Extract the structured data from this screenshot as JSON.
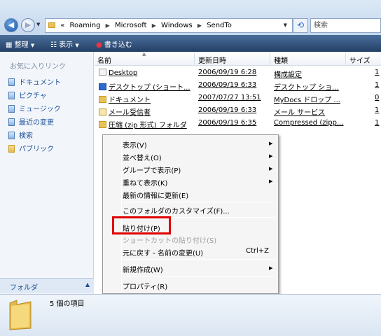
{
  "address": {
    "overflow": "«",
    "crumbs": [
      "Roaming",
      "Microsoft",
      "Windows",
      "SendTo"
    ],
    "search_placeholder": "検索"
  },
  "toolbar": {
    "organize": "整理",
    "views": "表示",
    "burn": "書き込む"
  },
  "nav": {
    "favorites_header": "お気に入りリンク",
    "items": [
      "ドキュメント",
      "ピクチャ",
      "ミュージック",
      "最近の変更",
      "検索",
      "パブリック"
    ],
    "folders_label": "フォルダ"
  },
  "columns": {
    "name": "名前",
    "date": "更新日時",
    "type": "種類",
    "size": "サイズ"
  },
  "files": [
    {
      "name": "Desktop",
      "date": "2006/09/19 6:28",
      "type": "構成設定",
      "size": "1"
    },
    {
      "name": "デスクトップ (ショート...",
      "date": "2006/09/19 6:33",
      "type": "デスクトップ ショ...",
      "size": "1"
    },
    {
      "name": "ドキュメント",
      "date": "2007/07/27 13:51",
      "type": "MyDocs ドロップ ...",
      "size": "0"
    },
    {
      "name": "メール受信者",
      "date": "2006/09/19 6:33",
      "type": "メール サービス",
      "size": "1"
    },
    {
      "name": "圧縮 (zip 形式) フォルダ",
      "date": "2006/09/19 6:35",
      "type": "Compressed (zipp...",
      "size": "1"
    }
  ],
  "context_menu": {
    "view": "表示(V)",
    "sort": "並べ替え(O)",
    "group": "グループで表示(P)",
    "stack": "重ねて表示(K)",
    "refresh": "最新の情報に更新(E)",
    "customize": "このフォルダのカスタマイズ(F)...",
    "paste": "貼り付け(P)",
    "paste_shortcut": "ショートカットの貼り付け(S)",
    "undo": "元に戻す - 名前の変更(U)",
    "undo_shortcut": "Ctrl+Z",
    "new": "新規作成(W)",
    "properties": "プロパティ(R)"
  },
  "details": {
    "item_count": "5 個の項目"
  },
  "colors": {
    "highlight": "#e00000",
    "toolbar": "#2d4b74",
    "nav_text": "#1d4f99"
  }
}
